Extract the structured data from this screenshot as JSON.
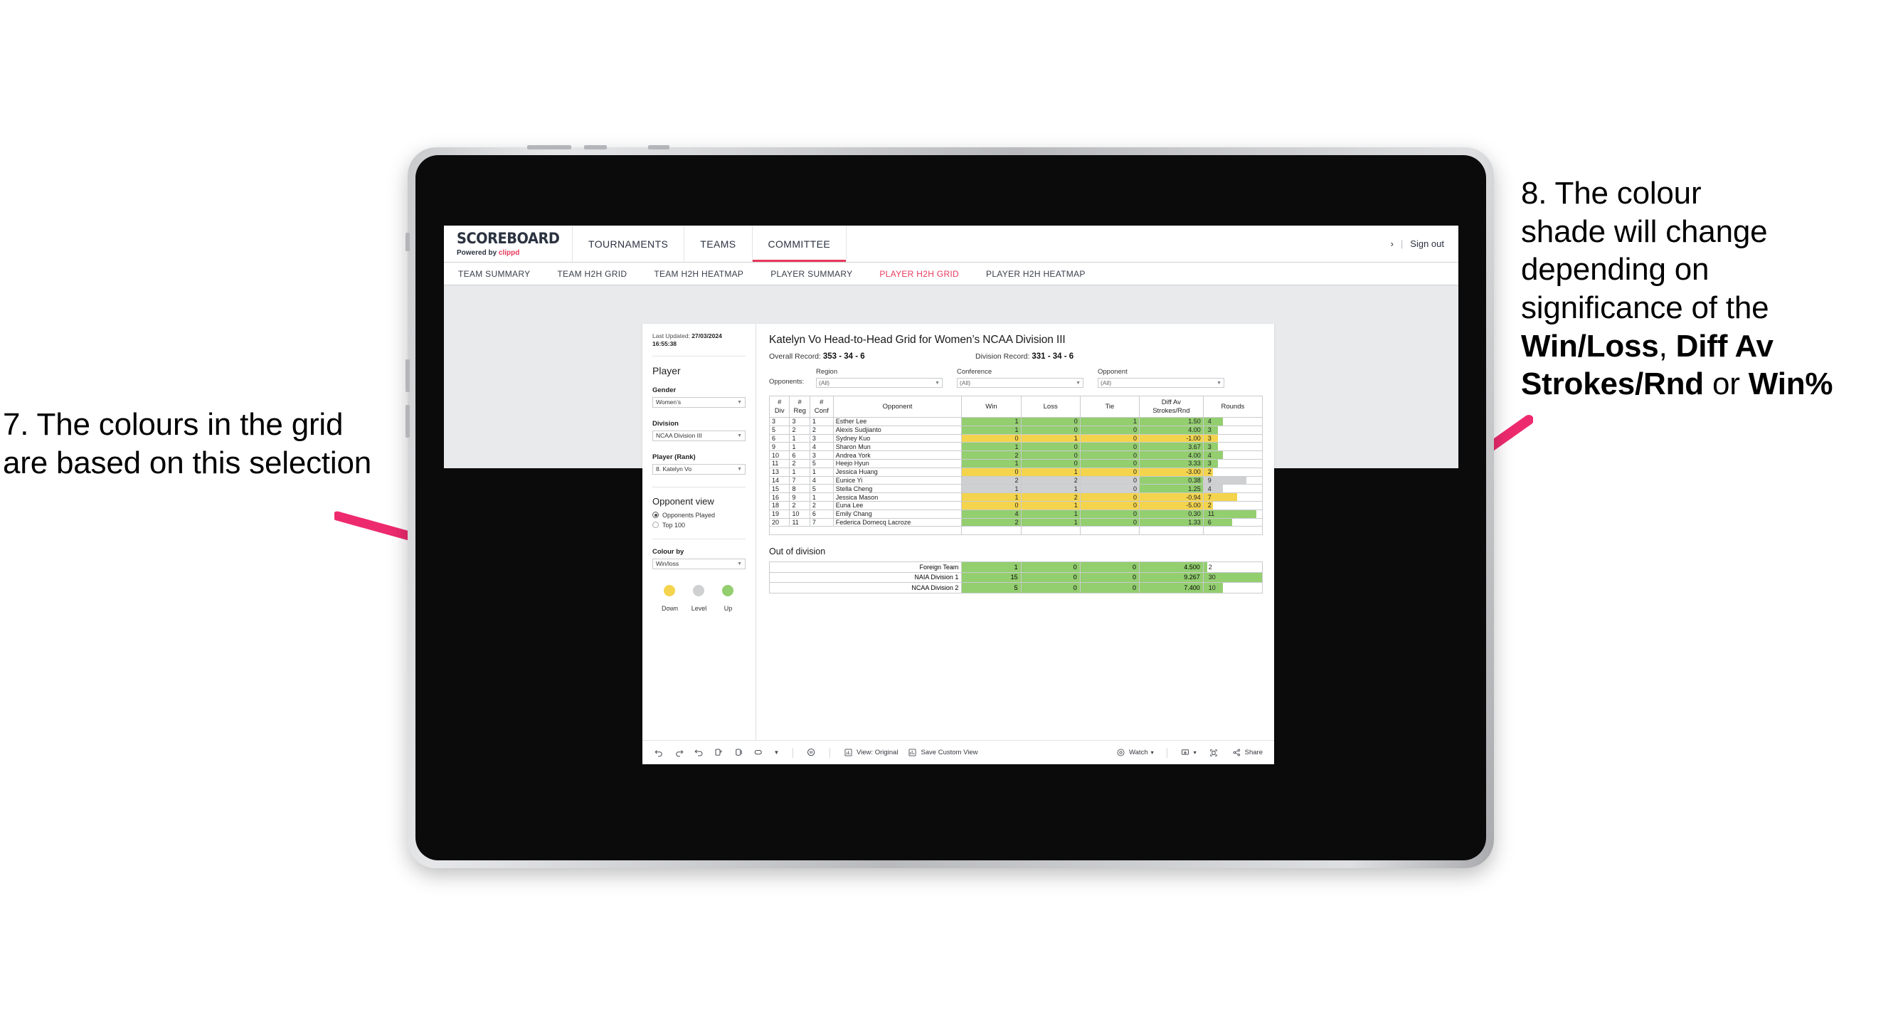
{
  "annotations": {
    "left": {
      "name": "annotation-7",
      "text": "7. The colours in the grid are based on this selection"
    },
    "right": {
      "name": "annotation-8",
      "line1": "8. The colour",
      "line2": "shade will change",
      "line3": "depending on",
      "line4": "significance of the ",
      "bold1": "Win/Loss",
      "mid1": ", ",
      "bold2": "Diff Av Strokes/Rnd",
      "mid2": " or ",
      "bold3": "Win%"
    }
  },
  "topnav": {
    "brand_title": "SCOREBOARD",
    "brand_sub_prefix": "Powered by ",
    "brand_sub_name": "clippd",
    "items": [
      {
        "label": "TOURNAMENTS",
        "active": false
      },
      {
        "label": "TEAMS",
        "active": false
      },
      {
        "label": "COMMITTEE",
        "active": true
      }
    ],
    "chevron": "›",
    "separator": "|",
    "sign_out": "Sign out"
  },
  "subnav": {
    "items": [
      {
        "label": "TEAM SUMMARY",
        "active": false
      },
      {
        "label": "TEAM H2H GRID",
        "active": false
      },
      {
        "label": "TEAM H2H HEATMAP",
        "active": false
      },
      {
        "label": "PLAYER SUMMARY",
        "active": false
      },
      {
        "label": "PLAYER H2H GRID",
        "active": true
      },
      {
        "label": "PLAYER H2H HEATMAP",
        "active": false
      }
    ]
  },
  "sidebar": {
    "last_updated_label": "Last Updated: ",
    "last_updated_value": "27/03/2024 16:55:38",
    "section_player": "Player",
    "gender_label": "Gender",
    "gender_value": "Women’s",
    "division_label": "Division",
    "division_value": "NCAA Division III",
    "player_rank_label": "Player (Rank)",
    "player_rank_value": "8. Katelyn Vo",
    "opponent_view_label": "Opponent view",
    "opponent_view_options": [
      {
        "label": "Opponents Played",
        "selected": true
      },
      {
        "label": "Top 100",
        "selected": false
      }
    ],
    "colour_by_label": "Colour by",
    "colour_by_value": "Win/loss",
    "legend": [
      {
        "label": "Down",
        "color": "#f4d44d"
      },
      {
        "label": "Level",
        "color": "#cfd0d1"
      },
      {
        "label": "Up",
        "color": "#93ce6f"
      }
    ]
  },
  "viz": {
    "title": "Katelyn Vo Head-to-Head Grid for Women’s NCAA Division III",
    "overall_record_label": "Overall Record: ",
    "overall_record_value": "353 -  34 - 6",
    "division_record_label": "Division Record: ",
    "division_record_value": "331 -  34 - 6",
    "opponents_label": "Opponents:",
    "filters": [
      {
        "caption": "Region",
        "value": "(All)"
      },
      {
        "caption": "Conference",
        "value": "(All)"
      },
      {
        "caption": "Opponent",
        "value": "(All)"
      }
    ],
    "out_of_division_title": "Out of division"
  },
  "chart_data": {
    "type": "table",
    "title": "Katelyn Vo Head-to-Head Grid for Women’s NCAA Division III",
    "columns": [
      "# Div",
      "# Reg",
      "# Conf",
      "Opponent",
      "Win",
      "Loss",
      "Tie",
      "Diff Av Strokes/Rnd",
      "Rounds"
    ],
    "column_headers_multiline": [
      [
        "#",
        "Div"
      ],
      [
        "#",
        "Reg"
      ],
      [
        "#",
        "Conf"
      ],
      [
        "Opponent"
      ],
      [
        "Win"
      ],
      [
        "Loss"
      ],
      [
        "Tie"
      ],
      [
        "Diff Av",
        "Strokes/Rnd"
      ],
      [
        "Rounds"
      ]
    ],
    "rounds_max": 30,
    "rows": [
      {
        "div": "3",
        "reg": "3",
        "conf": "1",
        "opponent": "Esther Lee",
        "win": "1",
        "loss": "0",
        "tie": "1",
        "diff": "1.50",
        "rounds": "4",
        "state": "up"
      },
      {
        "div": "5",
        "reg": "2",
        "conf": "2",
        "opponent": "Alexis Sudjianto",
        "win": "1",
        "loss": "0",
        "tie": "0",
        "diff": "4.00",
        "rounds": "3",
        "state": "up"
      },
      {
        "div": "6",
        "reg": "1",
        "conf": "3",
        "opponent": "Sydney Kuo",
        "win": "0",
        "loss": "1",
        "tie": "0",
        "diff": "-1.00",
        "rounds": "3",
        "state": "down"
      },
      {
        "div": "9",
        "reg": "1",
        "conf": "4",
        "opponent": "Sharon Mun",
        "win": "1",
        "loss": "0",
        "tie": "0",
        "diff": "3.67",
        "rounds": "3",
        "state": "up"
      },
      {
        "div": "10",
        "reg": "6",
        "conf": "3",
        "opponent": "Andrea York",
        "win": "2",
        "loss": "0",
        "tie": "0",
        "diff": "4.00",
        "rounds": "4",
        "state": "up"
      },
      {
        "div": "11",
        "reg": "2",
        "conf": "5",
        "opponent": "Heejo Hyun",
        "win": "1",
        "loss": "0",
        "tie": "0",
        "diff": "3.33",
        "rounds": "3",
        "state": "up"
      },
      {
        "div": "13",
        "reg": "1",
        "conf": "1",
        "opponent": "Jessica Huang",
        "win": "0",
        "loss": "1",
        "tie": "0",
        "diff": "-3.00",
        "rounds": "2",
        "state": "down"
      },
      {
        "div": "14",
        "reg": "7",
        "conf": "4",
        "opponent": "Eunice Yi",
        "win": "2",
        "loss": "2",
        "tie": "0",
        "diff": "0.38",
        "rounds": "9",
        "state": "level",
        "diff_state": "up"
      },
      {
        "div": "15",
        "reg": "8",
        "conf": "5",
        "opponent": "Stella Cheng",
        "win": "1",
        "loss": "1",
        "tie": "0",
        "diff": "1.25",
        "rounds": "4",
        "state": "level",
        "diff_state": "up"
      },
      {
        "div": "16",
        "reg": "9",
        "conf": "1",
        "opponent": "Jessica Mason",
        "win": "1",
        "loss": "2",
        "tie": "0",
        "diff": "-0.94",
        "rounds": "7",
        "state": "down"
      },
      {
        "div": "18",
        "reg": "2",
        "conf": "2",
        "opponent": "Euna Lee",
        "win": "0",
        "loss": "1",
        "tie": "0",
        "diff": "-5.00",
        "rounds": "2",
        "state": "down"
      },
      {
        "div": "19",
        "reg": "10",
        "conf": "6",
        "opponent": "Emily Chang",
        "win": "4",
        "loss": "1",
        "tie": "0",
        "diff": "0.30",
        "rounds": "11",
        "state": "up"
      },
      {
        "div": "20",
        "reg": "11",
        "conf": "7",
        "opponent": "Federica Domecq Lacroze",
        "win": "2",
        "loss": "1",
        "tie": "0",
        "diff": "1.33",
        "rounds": "6",
        "state": "up"
      }
    ],
    "out_of_division": {
      "rounds_max": 30,
      "rows": [
        {
          "name": "Foreign Team",
          "win": "1",
          "loss": "0",
          "tie": "0",
          "diff": "4.500",
          "rounds": "2",
          "state": "up"
        },
        {
          "name": "NAIA Division 1",
          "win": "15",
          "loss": "0",
          "tie": "0",
          "diff": "9.267",
          "rounds": "30",
          "state": "up"
        },
        {
          "name": "NCAA Division 2",
          "win": "5",
          "loss": "0",
          "tie": "0",
          "diff": "7.400",
          "rounds": "10",
          "state": "up"
        }
      ]
    },
    "colors": {
      "up": "#93ce6f",
      "down": "#f4d44d",
      "level": "#cfd0d1",
      "none": "#ffffff"
    }
  },
  "toolbar": {
    "view_label": "View: Original",
    "save_label": "Save Custom View",
    "watch_label": "Watch",
    "share_label": "Share",
    "caret": "▾"
  }
}
